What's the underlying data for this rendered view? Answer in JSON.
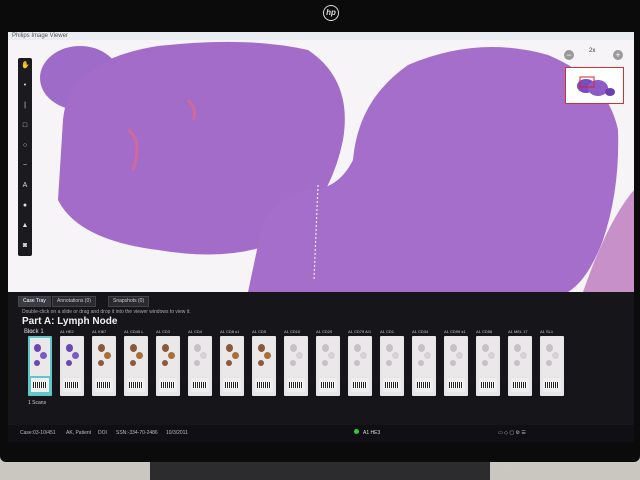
{
  "titlebar": {
    "title": "Philips Image Viewer"
  },
  "viewer": {
    "zoom": "2x"
  },
  "panel": {
    "tabs": [
      {
        "label": "Case Tray",
        "active": true
      },
      {
        "label": "Annotations (0)",
        "active": false
      },
      {
        "label": "Snapshots (0)",
        "active": false
      }
    ],
    "hint": "Double-click on a slide or drag and drop it into the viewer windows to view it.",
    "part_title": "Part A: Lymph Node",
    "block_label": "Block 1",
    "slides": [
      {
        "label": "A1",
        "stain": "he"
      },
      {
        "label": "A1 HE2",
        "stain": "he"
      },
      {
        "label": "A1 KI67",
        "stain": "ihc"
      },
      {
        "label": "A1 CD45 L",
        "stain": "ihc"
      },
      {
        "label": "A1 CD3",
        "stain": "ihc"
      },
      {
        "label": "A1 CD4",
        "stain": "light"
      },
      {
        "label": "A1 CD8 s1",
        "stain": "ihc"
      },
      {
        "label": "A1 CD5",
        "stain": "ihc"
      },
      {
        "label": "A1 CD10",
        "stain": "light"
      },
      {
        "label": "A1 CD20",
        "stain": "light"
      },
      {
        "label": "A1 CD79 A/1",
        "stain": "light"
      },
      {
        "label": "A1 CD1",
        "stain": "light"
      },
      {
        "label": "A1 CD34",
        "stain": "light"
      },
      {
        "label": "A1 CD99 s1",
        "stain": "light"
      },
      {
        "label": "A1 CD56",
        "stain": "light"
      },
      {
        "label": "A1 MEL 17",
        "stain": "light"
      },
      {
        "label": "A1 SL1",
        "stain": "light"
      }
    ],
    "selected_note": "1 Scans"
  },
  "status": {
    "case": "Case:03-10/451",
    "patient": "AK, Patient",
    "sex": "DOI",
    "ssn": "SSN:-334-70-2486",
    "date": "10/3/2011",
    "slide": "A1 HE3"
  },
  "colors": {
    "tissue": "#a06ac8",
    "background": "#f6f4f7",
    "panel": "#16161a",
    "selection": "#5fc7c8"
  }
}
